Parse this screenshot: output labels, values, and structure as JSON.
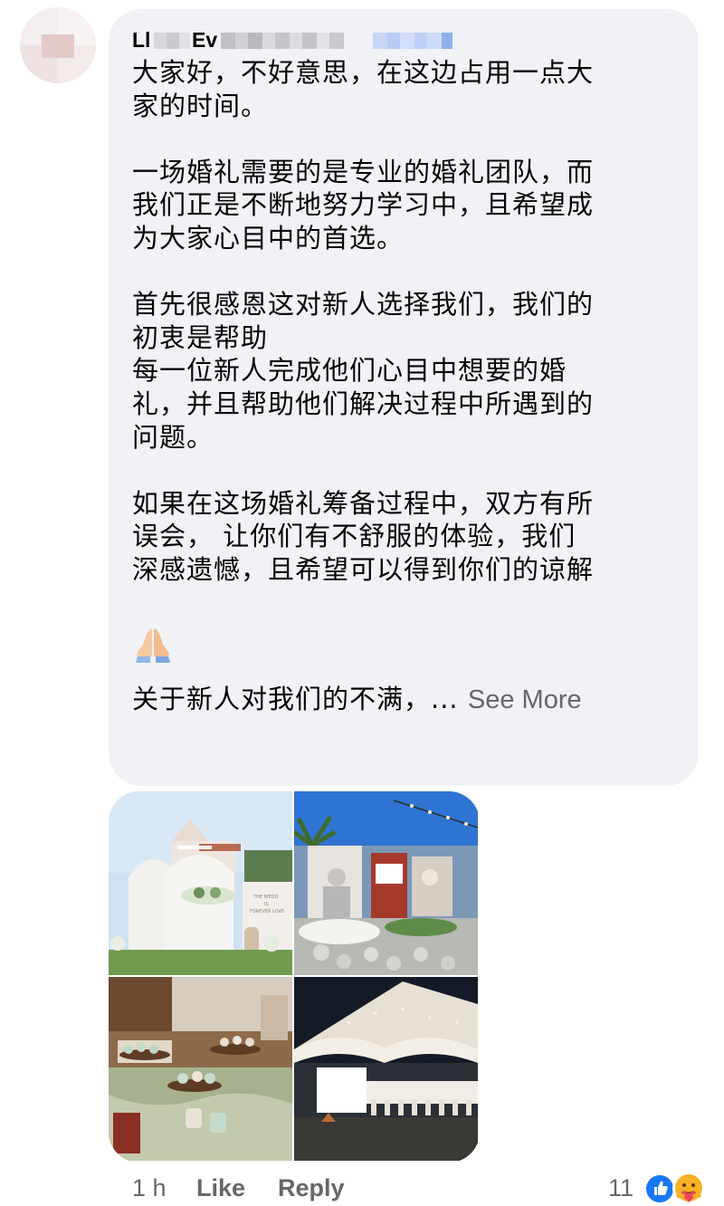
{
  "comment": {
    "author_visible": "Ll",
    "author_visible_2": "Ev",
    "paragraphs": [
      "大家好，不好意思，在这边占用一点大\n家的时间。",
      "一场婚礼需要的是专业的婚礼团队，而\n我们正是不断地努力学习中，且希望成\n为大家心目中的首选。",
      "首先很感恩这对新人选择我们，我们的\n初衷是帮助\n每一位新人完成他们心目中想要的婚\n礼，并且帮助他们解决过程中所遇到的\n问题。",
      "如果在这场婚礼筹备过程中，双方有所\n误会， 让你们有不舒服的体验，我们\n深感遗憾，且希望可以得到你们的谅解"
    ],
    "truncated_line": "关于新人对我们的不满，... ",
    "see_more_label": "See More",
    "emoji": "folded-hands-icon"
  },
  "gallery": {
    "photo_count": 4,
    "photo_texts": {
      "sign_line1": "THE WEDD",
      "sign_line2": "IS",
      "sign_line3": "FOREVER LOVE"
    }
  },
  "actions": {
    "time": "1 h",
    "like_label": "Like",
    "reply_label": "Reply"
  },
  "reactions": {
    "count": "11",
    "types": [
      "like-reaction-icon",
      "care-reaction-icon"
    ]
  },
  "colors": {
    "bubble": "#f0f2f5",
    "text": "#050505",
    "secondary": "#65676b",
    "like_blue": "#1877f2"
  }
}
